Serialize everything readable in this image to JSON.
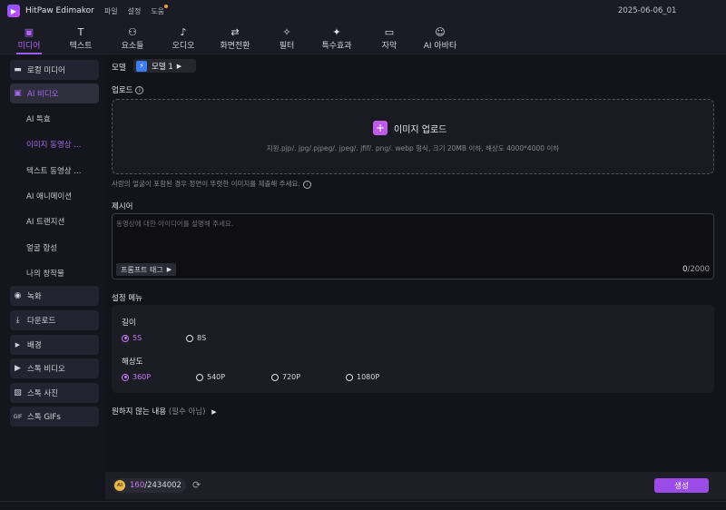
{
  "app": {
    "name": "HitPaw Edimakor",
    "date": "2025-06-06_01",
    "menu": [
      "파일",
      "설정",
      "도움"
    ]
  },
  "toolbar": {
    "tabs": [
      {
        "label": "미디어",
        "icon": "media-icon"
      },
      {
        "label": "텍스트",
        "icon": "text-icon"
      },
      {
        "label": "요소들",
        "icon": "elements-icon"
      },
      {
        "label": "오디오",
        "icon": "audio-icon"
      },
      {
        "label": "화면전환",
        "icon": "transition-icon"
      },
      {
        "label": "필터",
        "icon": "filter-icon"
      },
      {
        "label": "특수효과",
        "icon": "effects-icon"
      },
      {
        "label": "자막",
        "icon": "subtitle-icon"
      },
      {
        "label": "AI 아바타",
        "icon": "avatar-icon"
      }
    ]
  },
  "sidebar": {
    "local_media": "로컬 미디어",
    "ai_video": "AI 비디오",
    "sub": [
      "AI 특효",
      "이미지 동영상 ...",
      "텍스트 동영상 ...",
      "AI 애니메이션",
      "AI 트랜지션",
      "얼굴 합성",
      "나의 창작물"
    ],
    "record": "녹화",
    "download": "다운로드",
    "background": "배경",
    "stock_video": "스톡 비디오",
    "stock_photo": "스톡 사진",
    "stock_gif": "스톡 GIFs"
  },
  "main": {
    "model_label": "모델",
    "model_value": "모델 1",
    "upload_label": "업로드",
    "upload_button": "이미지 업로드",
    "upload_hint": "지원.pjp/. jpg/.pjpeg/. jpeg/. jfif/. png/. webp 형식, 크기 20MB 이하, 해상도 4000*4000 이하",
    "face_hint": "사람의 얼굴이 포함된 경우 정면이 뚜렷한 이미지를 제출해 주세요.",
    "prompt_label": "제시어",
    "prompt_placeholder": "동영상에 대한 아이디어를 설명해 주세요.",
    "prompt_tag": "프롬프트 태그",
    "counter_current": "0",
    "counter_max": "/2000",
    "settings_label": "설정 메뉴",
    "length_label": "길이",
    "length_options": [
      "5S",
      "8S"
    ],
    "resolution_label": "해상도",
    "resolution_options": [
      "360P",
      "540P",
      "720P",
      "1080P"
    ],
    "negative_label": "원하지 않는 내용",
    "negative_optional": "(필수 아님)"
  },
  "bottom": {
    "credits_used": "160",
    "credits_total": "/2434002",
    "generate": "생성"
  },
  "colors": {
    "accent": "#9a4be8",
    "highlight": "#c47af5",
    "bg": "#15151d"
  }
}
